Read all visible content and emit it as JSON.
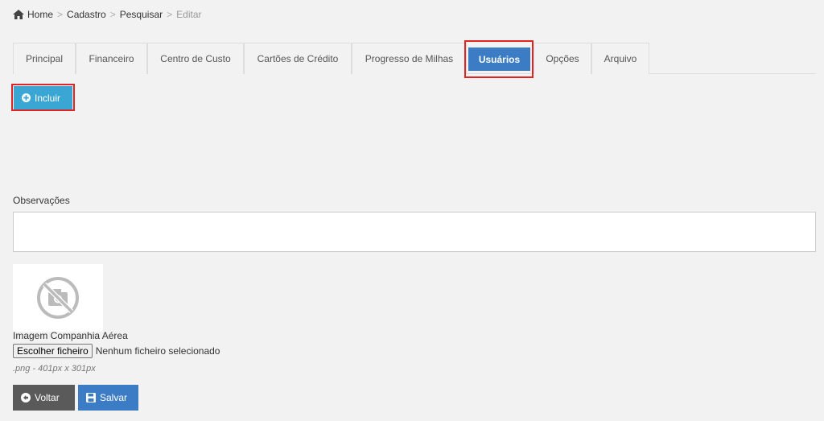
{
  "breadcrumb": {
    "items": [
      "Home",
      "Cadastro",
      "Pesquisar",
      "Editar"
    ]
  },
  "tabs": [
    {
      "label": "Principal"
    },
    {
      "label": "Financeiro"
    },
    {
      "label": "Centro de Custo"
    },
    {
      "label": "Cartões de Crédito"
    },
    {
      "label": "Progresso de Milhas"
    },
    {
      "label": "Usuários"
    },
    {
      "label": "Opções"
    },
    {
      "label": "Arquivo"
    }
  ],
  "active_tab": "Usuários",
  "actions": {
    "incluir_label": "Incluir",
    "voltar_label": "Voltar",
    "salvar_label": "Salvar"
  },
  "observacoes": {
    "label": "Observações",
    "value": ""
  },
  "image_upload": {
    "label": "Imagem Companhia Aérea",
    "button_label": "Escolher ficheiro",
    "status": "Nenhum ficheiro selecionado",
    "hint": ".png - 401px x 301px"
  },
  "colors": {
    "primary": "#3c7cc4",
    "info": "#3aa6d4",
    "dark": "#5a5a5a",
    "highlight": "#e02424"
  }
}
